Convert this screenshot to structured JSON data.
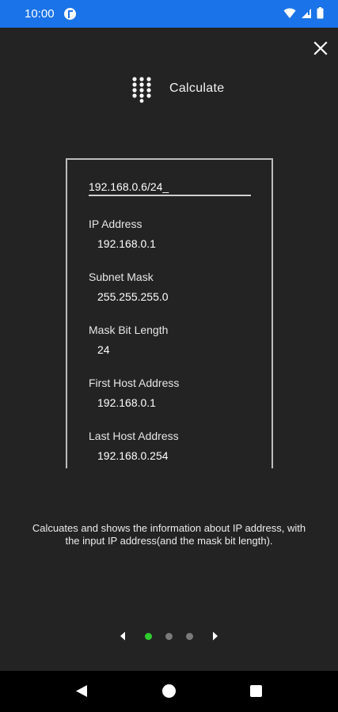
{
  "status_bar": {
    "time": "10:00",
    "background": "#1a73e8",
    "icons": [
      "app-notification-icon",
      "wifi-icon",
      "cellular-signal-icon",
      "battery-icon"
    ]
  },
  "header": {
    "icon": "dialpad-icon",
    "title": "Calculate"
  },
  "calculator": {
    "input_value": "192.168.0.6/24_",
    "fields": [
      {
        "label": "IP Address",
        "value": "192.168.0.1"
      },
      {
        "label": "Subnet Mask",
        "value": "255.255.255.0"
      },
      {
        "label": "Mask Bit Length",
        "value": "24"
      },
      {
        "label": "First Host Address",
        "value": "192.168.0.1"
      },
      {
        "label": "Last Host Address",
        "value": "192.168.0.254"
      }
    ]
  },
  "description": "Calcuates and shows the information about IP address, with the input IP address(and the mask bit length).",
  "pager": {
    "total_pages": 3,
    "current_page": 1,
    "active_color": "#2ecc2e",
    "inactive_color": "#7a7a7a"
  },
  "close_icon": "close-icon",
  "nav_bar": {
    "icons": [
      "back-icon",
      "home-icon",
      "recents-icon"
    ]
  }
}
